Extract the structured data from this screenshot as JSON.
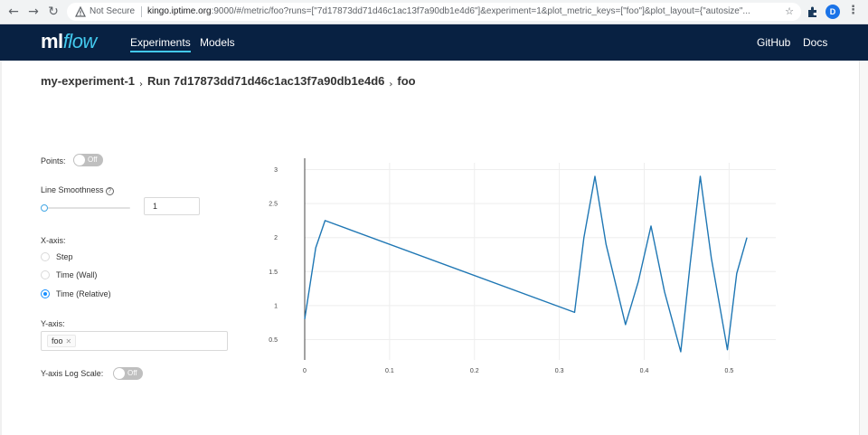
{
  "browser": {
    "not_secure": "Not Secure",
    "url_host": "kingo.iptime.org",
    "url_rest": ":9000/#/metric/foo?runs=[\"7d17873dd71d46c1ac13f7a90db1e4d6\"]&experiment=1&plot_metric_keys=[\"foo\"]&plot_layout={\"autosize\"...",
    "avatar_letter": "D"
  },
  "header": {
    "logo_ml": "ml",
    "logo_flow": "flow",
    "nav": [
      "Experiments",
      "Models"
    ],
    "right_links": [
      "GitHub",
      "Docs"
    ]
  },
  "breadcrumb": {
    "experiment": "my-experiment-1",
    "run": "Run 7d17873dd71d46c1ac13f7a90db1e4d6",
    "metric": "foo"
  },
  "controls": {
    "points_label": "Points:",
    "points_toggle": "Off",
    "smoothness_label": "Line Smoothness",
    "smoothness_value": "1",
    "xaxis_label": "X-axis:",
    "xaxis_options": [
      "Step",
      "Time (Wall)",
      "Time (Relative)"
    ],
    "xaxis_selected": "Time (Relative)",
    "yaxis_label": "Y-axis:",
    "yaxis_tags": [
      "foo"
    ],
    "log_scale_label": "Y-axis Log Scale:",
    "log_scale_toggle": "Off"
  },
  "colors": {
    "header_bg": "#082142",
    "line": "#1f77b4",
    "accent": "#1890ff"
  },
  "chart_data": {
    "type": "line",
    "series": [
      {
        "x": [
          0,
          0.013,
          0.024,
          0.318,
          0.329,
          0.342,
          0.355,
          0.378,
          0.393,
          0.408,
          0.424,
          0.443,
          0.454,
          0.466,
          0.479,
          0.498,
          0.509,
          0.521
        ],
        "y": [
          0.8,
          1.85,
          2.25,
          0.9,
          2.0,
          2.9,
          1.9,
          0.72,
          1.35,
          2.17,
          1.2,
          0.32,
          1.6,
          2.9,
          1.7,
          0.35,
          1.47,
          2.0
        ]
      }
    ],
    "xlim": [
      0,
      0.555
    ],
    "ylim": [
      0.2,
      3.1
    ],
    "xticks": [
      0,
      0.1,
      0.2,
      0.3,
      0.4,
      0.5
    ],
    "yticks": [
      0.5,
      1,
      1.5,
      2,
      2.5,
      3
    ],
    "xtick_labels": [
      "0",
      "0.1",
      "0.2",
      "0.3",
      "0.4",
      "0.5"
    ],
    "ytick_labels": [
      "0.5",
      "1",
      "1.5",
      "2",
      "2.5",
      "3"
    ],
    "grid": true
  }
}
